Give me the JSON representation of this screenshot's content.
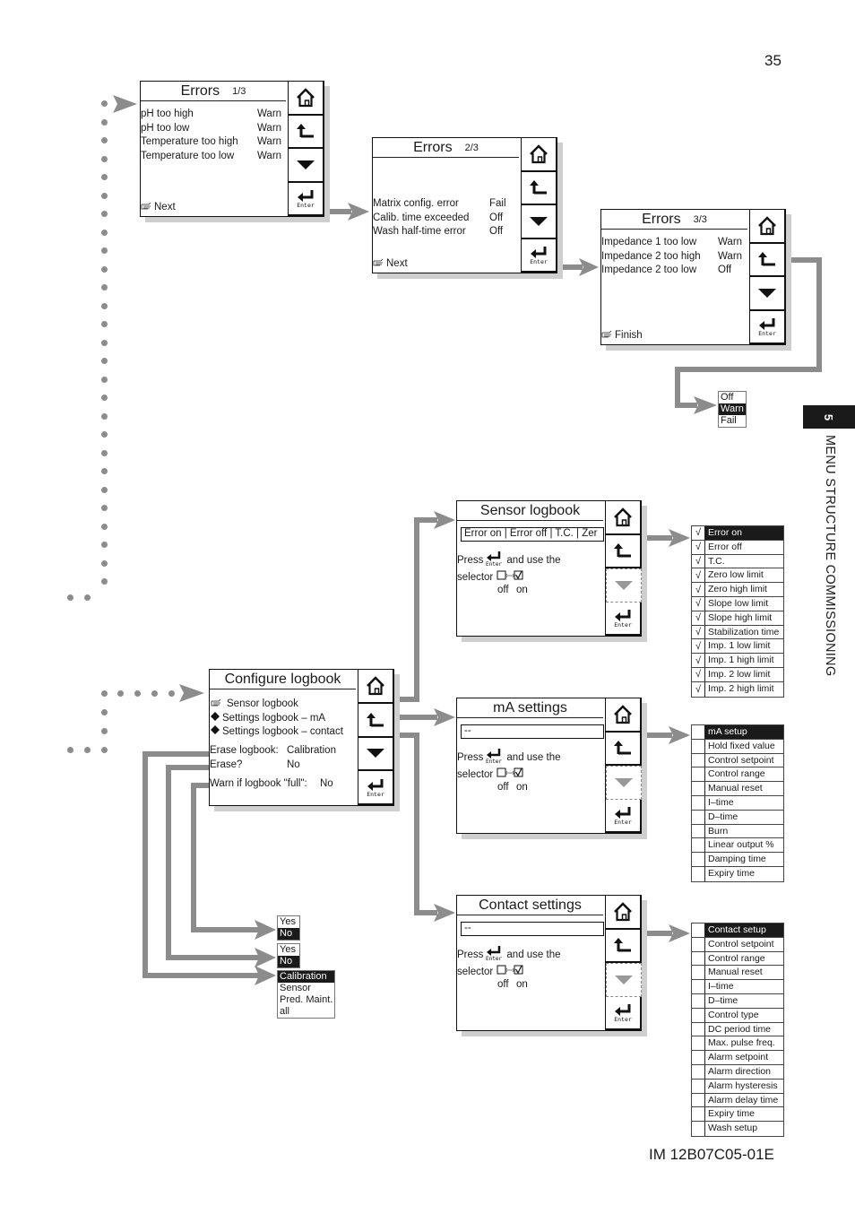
{
  "page": {
    "number": "35",
    "doc_id": "IM 12B07C05-01E",
    "chapter_number": "5",
    "chapter_title": "MENU STRUCTURE COMMISSIONING"
  },
  "buttons": {
    "home_icon": "home-icon",
    "back_icon": "back-arrow-icon",
    "down_icon": "down-triangle-icon",
    "enter_label": "Enter"
  },
  "errors1": {
    "title": "Errors",
    "page": "1/3",
    "rows": [
      {
        "label": "pH too high",
        "value": "Warn"
      },
      {
        "label": "pH too low",
        "value": "Warn"
      },
      {
        "label": "Temperature too high",
        "value": "Warn"
      },
      {
        "label": "Temperature too low",
        "value": "Warn"
      }
    ],
    "footer": "Next"
  },
  "errors2": {
    "title": "Errors",
    "page": "2/3",
    "rows": [
      {
        "label": "Matrix config. error",
        "value": "Fail"
      },
      {
        "label": "Calib. time exceeded",
        "value": "Off"
      },
      {
        "label": "Wash half-time error",
        "value": "Off"
      }
    ],
    "footer": "Next"
  },
  "errors3": {
    "title": "Errors",
    "page": "3/3",
    "rows": [
      {
        "label": "Impedance 1 too low",
        "value": "Warn"
      },
      {
        "label": "Impedance 2 too high",
        "value": "Warn"
      },
      {
        "label": "Impedance 2 too low",
        "value": "Off"
      }
    ],
    "footer": "Finish"
  },
  "error_level_options": {
    "items": [
      "Off",
      "Warn",
      "Fail"
    ],
    "selected": "Warn"
  },
  "configure": {
    "title": "Configure logbook",
    "menu": [
      "Sensor logbook",
      "Settings logbook – mA",
      "Settings logbook – contact"
    ],
    "erase_label": "Erase logbook:",
    "erase_value": "Calibration",
    "erase_q_label": "Erase?",
    "erase_q_value": "No",
    "warn_label": "Warn if logbook \"full\":",
    "warn_value": "No"
  },
  "sensor": {
    "title": "Sensor logbook",
    "field": "Error on | Error off | T.C. | Zer",
    "press": "Press",
    "and_use": "and use the",
    "selector": "selector",
    "off": "off",
    "on": "on"
  },
  "ma": {
    "title": "mA settings",
    "field": "--",
    "press": "Press",
    "and_use": "and use the",
    "selector": "selector",
    "off": "off",
    "on": "on"
  },
  "contact": {
    "title": "Contact settings",
    "field": "--",
    "press": "Press",
    "and_use": "and use the",
    "selector": "selector",
    "off": "off",
    "on": "on"
  },
  "sensor_list": {
    "items": [
      {
        "label": "Error on",
        "checked": true
      },
      {
        "label": "Error off",
        "checked": true
      },
      {
        "label": "T.C.",
        "checked": true
      },
      {
        "label": "Zero low limit",
        "checked": true
      },
      {
        "label": "Zero high limit",
        "checked": true
      },
      {
        "label": "Slope low limit",
        "checked": true
      },
      {
        "label": "Slope high limit",
        "checked": true
      },
      {
        "label": "Stabilization time",
        "checked": true
      },
      {
        "label": "Imp. 1 low limit",
        "checked": true
      },
      {
        "label": "Imp. 1 high limit",
        "checked": true
      },
      {
        "label": "Imp. 2 low limit",
        "checked": true
      },
      {
        "label": "Imp. 2 high limit",
        "checked": true
      }
    ],
    "selected": "Error on"
  },
  "ma_list": {
    "items": [
      {
        "label": "mA setup",
        "checked": false
      },
      {
        "label": "Hold fixed value",
        "checked": false
      },
      {
        "label": "Control setpoint",
        "checked": false
      },
      {
        "label": "Control range",
        "checked": false
      },
      {
        "label": "Manual reset",
        "checked": false
      },
      {
        "label": "I–time",
        "checked": false
      },
      {
        "label": "D–time",
        "checked": false
      },
      {
        "label": "Burn",
        "checked": false
      },
      {
        "label": "Linear output %",
        "checked": false
      },
      {
        "label": "Damping time",
        "checked": false
      },
      {
        "label": "Expiry time",
        "checked": false
      }
    ],
    "selected": "mA setup"
  },
  "contact_list": {
    "items": [
      {
        "label": "Contact setup",
        "checked": false
      },
      {
        "label": "Control setpoint",
        "checked": false
      },
      {
        "label": "Control range",
        "checked": false
      },
      {
        "label": "Manual reset",
        "checked": false
      },
      {
        "label": "I–time",
        "checked": false
      },
      {
        "label": "D–time",
        "checked": false
      },
      {
        "label": "Control type",
        "checked": false
      },
      {
        "label": "DC period time",
        "checked": false
      },
      {
        "label": "Max. pulse freq.",
        "checked": false
      },
      {
        "label": "Alarm setpoint",
        "checked": false
      },
      {
        "label": "Alarm direction",
        "checked": false
      },
      {
        "label": "Alarm hysteresis",
        "checked": false
      },
      {
        "label": "Alarm delay time",
        "checked": false
      },
      {
        "label": "Expiry time",
        "checked": false
      },
      {
        "label": "Wash setup",
        "checked": false
      }
    ],
    "selected": "Contact setup"
  },
  "warn_full_options": {
    "items": [
      "Yes",
      "No"
    ],
    "selected": "No"
  },
  "erase_q_options": {
    "items": [
      "Yes",
      "No"
    ],
    "selected": "No"
  },
  "erase_options": {
    "items": [
      "Calibration",
      "Sensor",
      "Pred. Maint.",
      "all"
    ],
    "selected": "Calibration"
  }
}
